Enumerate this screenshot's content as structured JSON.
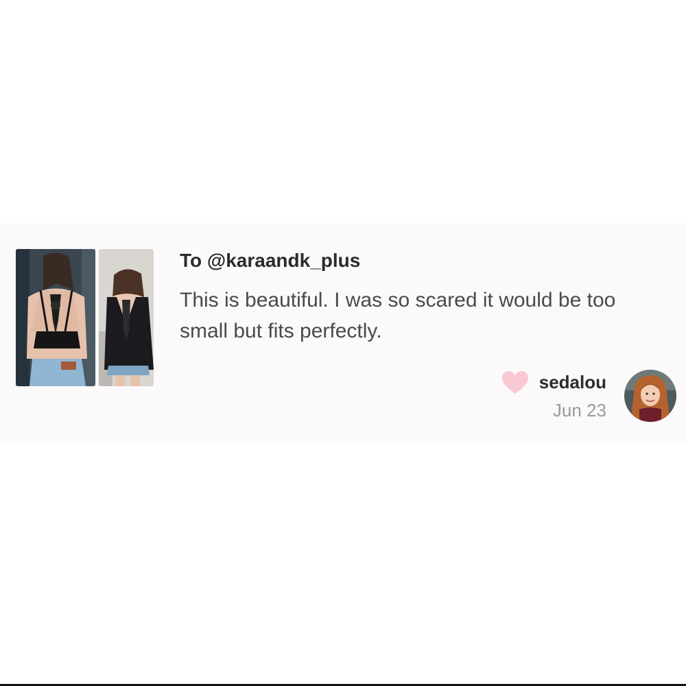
{
  "review": {
    "recipient": "To @karaandk_plus",
    "message": "This is beautiful. I was so scared it would be too small but fits perfectly.",
    "reviewer": {
      "username": "sedalou",
      "date": "Jun 23",
      "avatar": "reviewer-avatar"
    },
    "photos": [
      {
        "alt": "back-view-bralette-photo"
      },
      {
        "alt": "back-view-tank-top-photo"
      }
    ],
    "icon": "heart-icon"
  },
  "colors": {
    "card_background": "#fbf9fa",
    "heart": "#f9c8d3",
    "title_text": "#2b2b2b",
    "body_text": "#4a4a4a",
    "muted_text": "#9a9a9a"
  }
}
